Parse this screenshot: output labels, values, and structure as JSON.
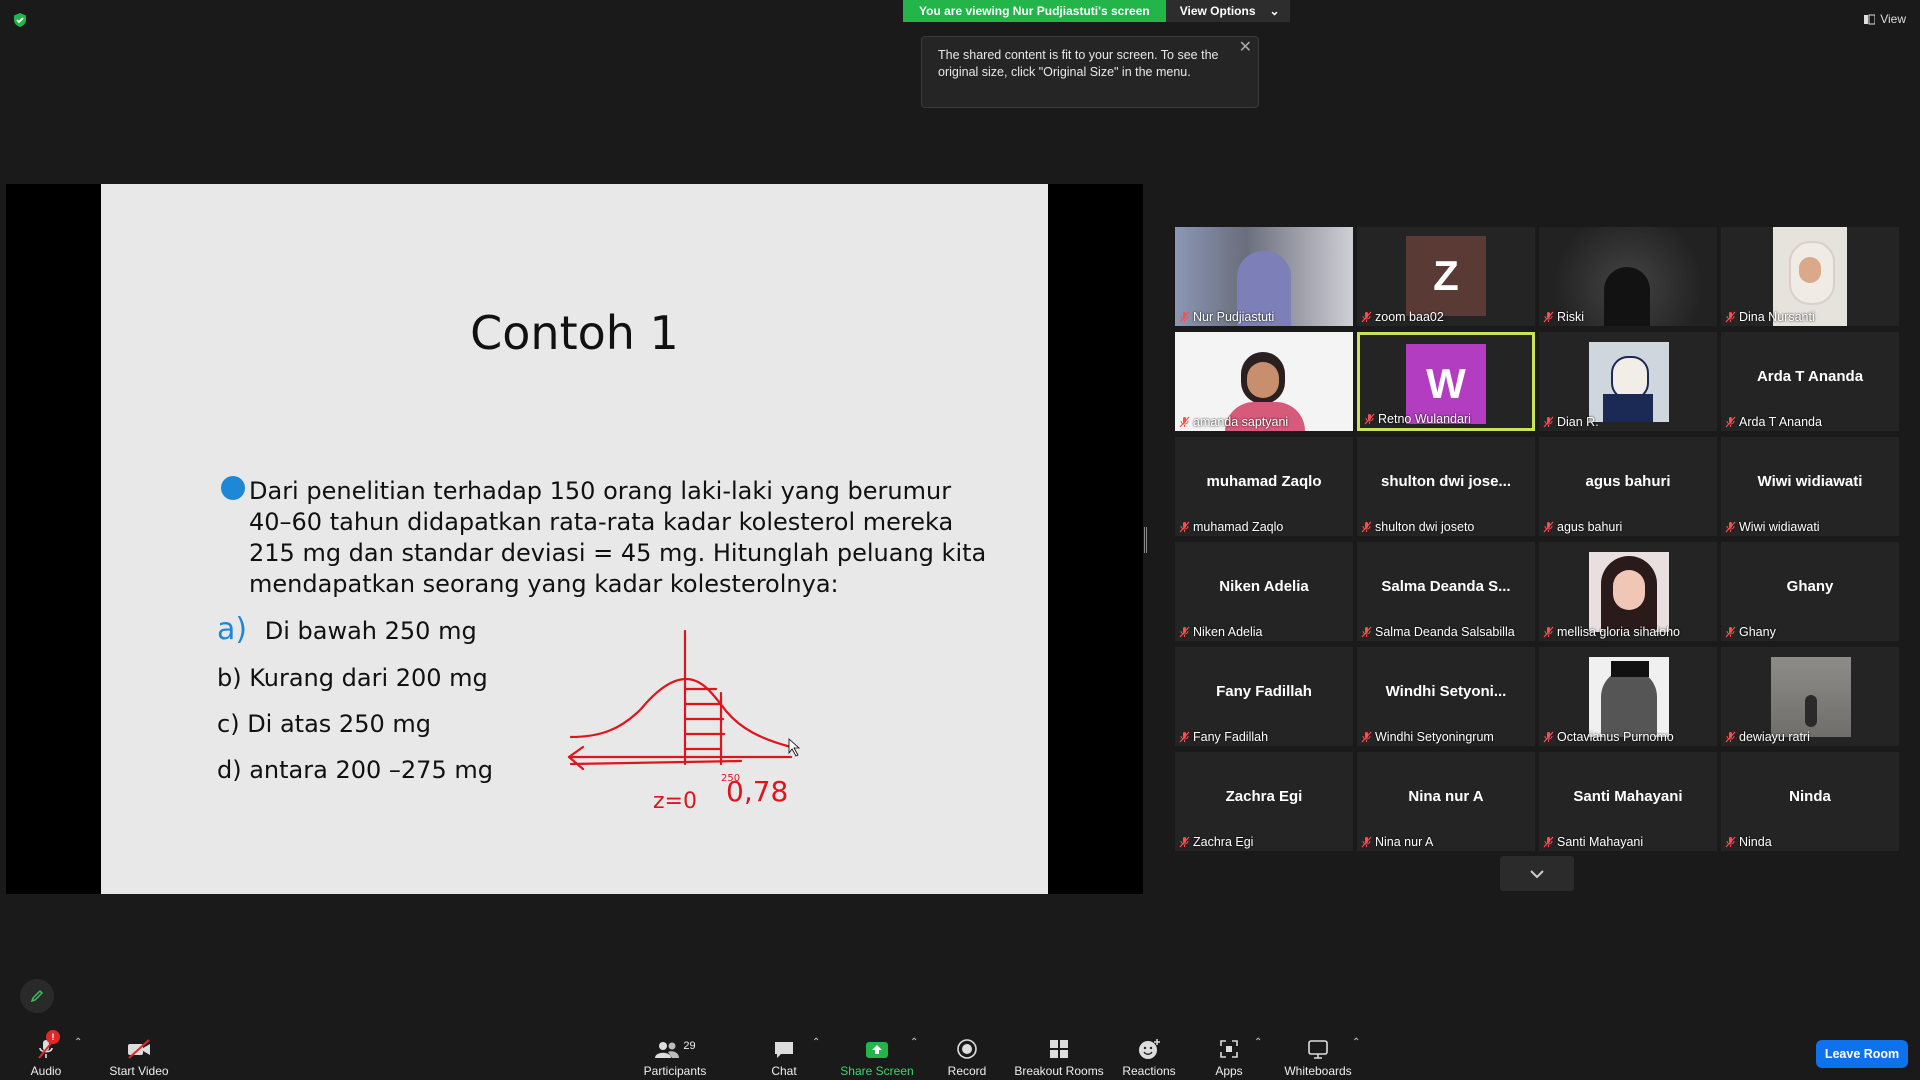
{
  "banner": {
    "viewing": "You are viewing Nur Pudjiastuti's screen",
    "view_options": "View Options"
  },
  "tooltip": {
    "text": "The shared content is fit to your screen. To see the original size, click \"Original Size\" in the menu."
  },
  "top_right": {
    "view_label": "View"
  },
  "slide": {
    "title": "Contoh 1",
    "problem": "Dari penelitian terhadap 150 orang laki-laki yang berumur 40–60 tahun didapatkan rata-rata kadar kolesterol mereka 215 mg dan standar deviasi = 45 mg. Hitunglah peluang kita mendapatkan seorang yang kadar kolesterolnya:",
    "options": [
      {
        "letter": "a)",
        "text": "Di bawah 250 mg"
      },
      {
        "letter": "",
        "text": "b) Kurang dari 200 mg"
      },
      {
        "letter": "",
        "text": "c) Di atas 250 mg"
      },
      {
        "letter": "",
        "text": "d) antara 200 –275 mg"
      }
    ],
    "annotation": {
      "z0": "z=0",
      "z1": "0,78",
      "z1_top": "250"
    }
  },
  "participants": [
    {
      "display": "",
      "name": "Nur Pudjiastuti",
      "type": "photo",
      "active": false
    },
    {
      "display": "Z",
      "name": "zoom baa02",
      "type": "letter",
      "color": "#5a3a34",
      "active": false
    },
    {
      "display": "",
      "name": "Riski",
      "type": "photo",
      "active": false
    },
    {
      "display": "",
      "name": "Dina Nursanti",
      "type": "photo",
      "active": false
    },
    {
      "display": "",
      "name": "amanda saptyani",
      "type": "photo",
      "active": false
    },
    {
      "display": "W",
      "name": "Retno Wulandari",
      "type": "letter",
      "color": "#b23dc1",
      "active": true
    },
    {
      "display": "",
      "name": "Dian R.",
      "type": "photo",
      "active": false
    },
    {
      "display": "Arda T Ananda",
      "name": "Arda T Ananda",
      "type": "name",
      "active": false
    },
    {
      "display": "muhamad Zaqlo",
      "name": "muhamad Zaqlo",
      "type": "name",
      "active": false
    },
    {
      "display": "shulton dwi jose...",
      "name": "shulton dwi joseto",
      "type": "name",
      "active": false
    },
    {
      "display": "agus bahuri",
      "name": "agus bahuri",
      "type": "name",
      "active": false
    },
    {
      "display": "Wiwi widiawati",
      "name": "Wiwi widiawati",
      "type": "name",
      "active": false
    },
    {
      "display": "Niken Adelia",
      "name": "Niken Adelia",
      "type": "name",
      "active": false
    },
    {
      "display": "Salma Deanda S...",
      "name": "Salma Deanda Salsabilla",
      "type": "name",
      "active": false
    },
    {
      "display": "",
      "name": "mellisa gloria sihaloho",
      "type": "photo",
      "active": false
    },
    {
      "display": "Ghany",
      "name": "Ghany",
      "type": "name",
      "active": false
    },
    {
      "display": "Fany Fadillah",
      "name": "Fany Fadillah",
      "type": "name",
      "active": false
    },
    {
      "display": "Windhi Setyoni...",
      "name": "Windhi Setyoningrum",
      "type": "name",
      "active": false
    },
    {
      "display": "",
      "name": "Octavianus Purnomo",
      "type": "photo",
      "active": false
    },
    {
      "display": "",
      "name": "dewiayu ratri",
      "type": "photo",
      "active": false
    },
    {
      "display": "Zachra Egi",
      "name": "Zachra Egi",
      "type": "name",
      "active": false
    },
    {
      "display": "Nina nur A",
      "name": "Nina nur A",
      "type": "name",
      "active": false
    },
    {
      "display": "Santi Mahayani",
      "name": "Santi Mahayani",
      "type": "name",
      "active": false
    },
    {
      "display": "Ninda",
      "name": "Ninda",
      "type": "name",
      "active": false
    }
  ],
  "toolbar": {
    "audio": "Audio",
    "audio_badge": "!",
    "video": "Start Video",
    "participants": "Participants",
    "participants_count": "29",
    "chat": "Chat",
    "share": "Share Screen",
    "record": "Record",
    "breakout": "Breakout Rooms",
    "reactions": "Reactions",
    "apps": "Apps",
    "whiteboards": "Whiteboards",
    "leave": "Leave Room"
  },
  "colors": {
    "share_green": "#23b44a",
    "leave_blue": "#0e72ed",
    "active_border": "#c9e25a",
    "slide_blue": "#1f88d6",
    "annotation_red": "#e0141c"
  }
}
